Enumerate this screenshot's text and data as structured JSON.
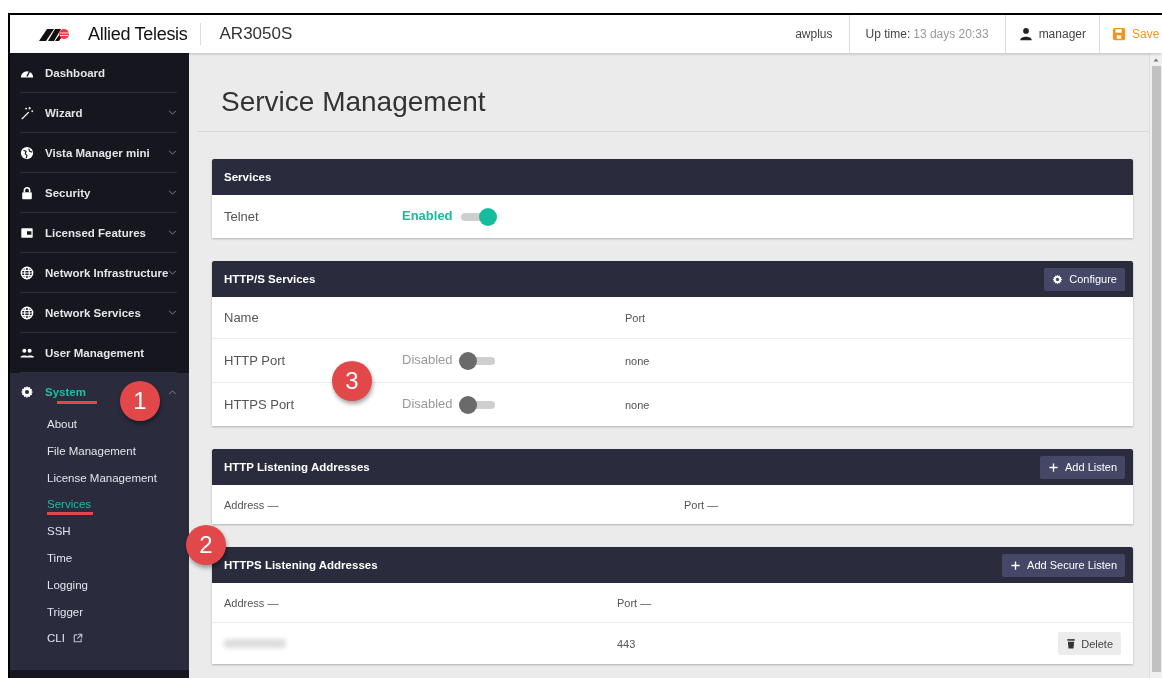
{
  "header": {
    "brand": "Allied Telesis",
    "device": "AR3050S",
    "hostname": "awplus",
    "uptime_label": "Up time:",
    "uptime_value": "13 days 20:33",
    "user": "manager",
    "save": "Save"
  },
  "sidebar": {
    "items": [
      {
        "label": "Dashboard",
        "selected": false
      },
      {
        "label": "Wizard",
        "selected": false,
        "expanded": false
      },
      {
        "label": "Vista Manager mini",
        "selected": false,
        "expanded": false
      },
      {
        "label": "Security",
        "selected": false,
        "expanded": false
      },
      {
        "label": "Licensed Features",
        "selected": false,
        "expanded": false
      },
      {
        "label": "Network Infrastructure",
        "selected": false,
        "expanded": false
      },
      {
        "label": "Network Services",
        "selected": false,
        "expanded": false
      },
      {
        "label": "User Management",
        "selected": false
      },
      {
        "label": "System",
        "selected": true,
        "expanded": true,
        "underlined": true,
        "annotation": "1",
        "children": [
          {
            "label": "About",
            "selected": false
          },
          {
            "label": "File Management",
            "selected": false
          },
          {
            "label": "License Management",
            "selected": false
          },
          {
            "label": "Services",
            "selected": true,
            "underlined": true
          },
          {
            "label": "SSH",
            "selected": false
          },
          {
            "label": "Time",
            "selected": false
          },
          {
            "label": "Logging",
            "selected": false
          },
          {
            "label": "Trigger",
            "selected": false
          },
          {
            "label": "CLI",
            "selected": false,
            "external": true
          }
        ]
      }
    ]
  },
  "page": {
    "title": "Service Management"
  },
  "cards": [
    {
      "kind": "toggles",
      "title": "Services",
      "rows": [
        {
          "name": "Telnet",
          "status": "Enabled",
          "on": true
        }
      ]
    },
    {
      "kind": "services",
      "title": "HTTP/S Services",
      "button": "Configure",
      "columns": [
        {
          "label": "Name"
        },
        {
          "label": "Port"
        }
      ],
      "rows": [
        {
          "name": "HTTP Port",
          "status": "Disabled",
          "on": false,
          "port": "none",
          "annotation": "3"
        },
        {
          "name": "HTTPS Port",
          "status": "Disabled",
          "on": false,
          "port": "none"
        }
      ]
    },
    {
      "kind": "addresses",
      "title": "HTTP Listening Addresses",
      "button": "Add Listen",
      "columns": [
        {
          "label": "Address",
          "sort": "—"
        },
        {
          "label": "Port",
          "sort": "—"
        }
      ]
    },
    {
      "kind": "secure_addresses",
      "title": "HTTPS Listening Addresses",
      "annotation": "2",
      "button": "Add Secure Listen",
      "columns": [
        {
          "label": "Address",
          "sort": "—"
        },
        {
          "label": "Port",
          "sort": "—"
        }
      ],
      "rows": [
        {
          "redacted": true,
          "port": "443",
          "action": "Delete"
        }
      ]
    }
  ]
}
